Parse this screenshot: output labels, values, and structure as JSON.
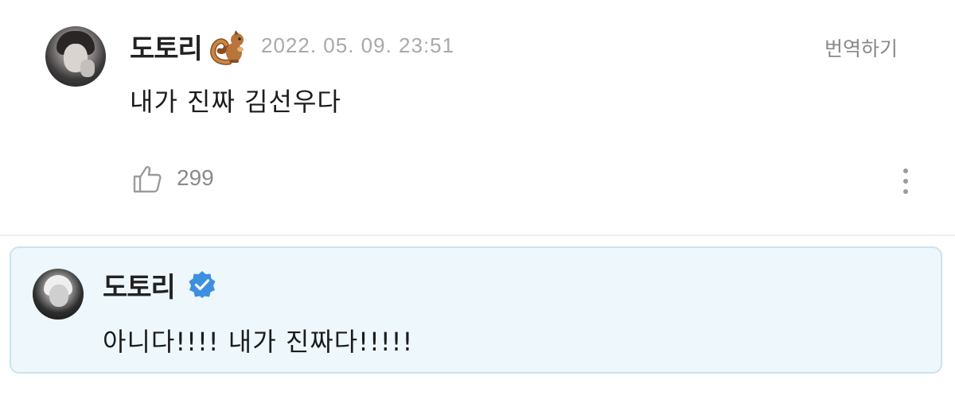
{
  "comment": {
    "author": "도토리",
    "author_emoji_icon": "squirrel-icon",
    "timestamp": "2022. 05. 09. 23:51",
    "translate_label": "번역하기",
    "body": "내가 진짜 김선우다",
    "like_icon": "thumbs-up-icon",
    "like_count": "299",
    "more_icon": "more-vertical-icon"
  },
  "reply": {
    "author": "도토리",
    "badge_icon": "verified-badge-icon",
    "body": "아니다!!!! 내가 진짜다!!!!!"
  },
  "colors": {
    "reply_background": "#eef7fc",
    "reply_border": "#cbe3ef",
    "verified_badge": "#3d8fe0",
    "muted_text": "#a9a9a9"
  }
}
